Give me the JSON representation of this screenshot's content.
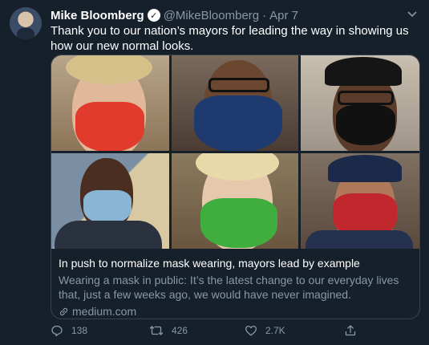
{
  "tweet": {
    "author_name": "Mike Bloomberg",
    "handle": "@MikeBloomberg",
    "separator": "·",
    "date": "Apr 7",
    "text": "Thank you to our nation’s mayors for leading the way in showing us how our new normal looks."
  },
  "card": {
    "title": "In push to normalize mask wearing, mayors lead by example",
    "description": "Wearing a mask in public: It’s the latest change to our everyday lives that, just a few weeks ago, we would have never imagined.",
    "domain": "medium.com"
  },
  "actions": {
    "replies": "138",
    "retweets": "426",
    "likes": "2.7K"
  },
  "icons": {
    "verified": "verified-badge-icon",
    "caret": "chevron-down-icon",
    "link": "link-icon",
    "reply": "reply-icon",
    "retweet": "retweet-icon",
    "like": "heart-icon",
    "share": "share-icon"
  },
  "colors": {
    "background": "#15202b",
    "secondary_text": "#8899a6",
    "border": "#38444d"
  }
}
